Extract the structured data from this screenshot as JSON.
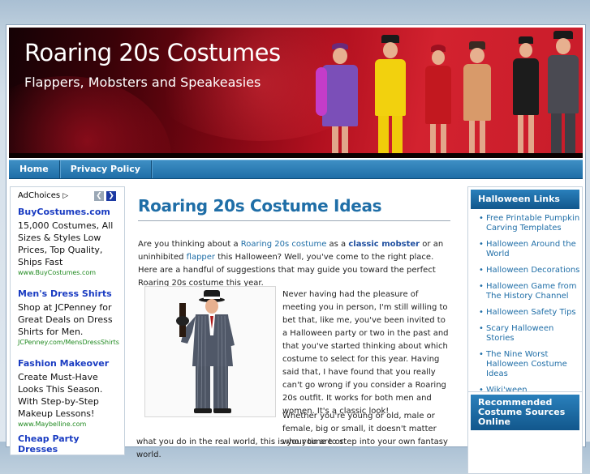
{
  "header": {
    "title": "Roaring 20s Costumes",
    "tagline": "Flappers, Mobsters and Speakeasies"
  },
  "nav": {
    "items": [
      {
        "label": "Home"
      },
      {
        "label": "Privacy Policy"
      }
    ]
  },
  "ads": {
    "adchoices_label": "AdChoices",
    "prev_label": "❮",
    "next_label": "❯",
    "items": [
      {
        "title": "BuyCostumes.com",
        "desc": "15,000 Costumes, All Sizes & Styles Low Prices, Top Quality, Ships Fast",
        "url": "www.BuyCostumes.com"
      },
      {
        "title": "Men's Dress Shirts",
        "desc": "Shop at JCPenney for Great Deals on Dress Shirts for Men.",
        "url": "JCPenney.com/MensDressShirts"
      },
      {
        "title": "Fashion Makeover",
        "desc": "Create Must-Have Looks This Season. With Step-by-Step Makeup Lessons!",
        "url": "www.Maybelline.com"
      },
      {
        "title": "Cheap Party Dresses",
        "desc": "",
        "url": ""
      }
    ]
  },
  "post": {
    "title": "Roaring 20s Costume Ideas",
    "p1_a": "Are you thinking about a ",
    "p1_link1": "Roaring 20s costume",
    "p1_b": " as a ",
    "p1_link2": "classic mobster",
    "p1_c": " or an uninhibited ",
    "p1_link3": "flapper",
    "p1_d": " this Halloween? Well, you've come to the right place. Here are a handful of suggestions that may guide you toward the perfect Roaring 20s costume this year.",
    "p2": "Never having had the pleasure of meeting you in person, I'm still willing to bet that, like me, you've been invited to a Halloween party or two in the past and that you've started thinking about which costume to select for this year. Having said that, I have found that you really can't go wrong if you consider a Roaring 20s outfit. It works for both men and women. It's a classic look!",
    "p3": "Whether you're young or old, male or female, big or small, it doesn't matter who you are or",
    "p3b": "what you do in the real world, this is your time to step into your own fantasy world."
  },
  "sidebar": {
    "links_title": "Halloween Links",
    "links": [
      {
        "label": "Free Printable Pumpkin Carving Templates"
      },
      {
        "label": "Halloween Around the World"
      },
      {
        "label": "Halloween Decorations"
      },
      {
        "label": "Halloween Game from The History Channel"
      },
      {
        "label": "Halloween Safety Tips"
      },
      {
        "label": "Scary Halloween Stories"
      },
      {
        "label": "The Nine Worst Halloween Costume Ideas"
      },
      {
        "label": "Wiki'ween"
      }
    ],
    "recommend_title": "Recommended Costume Sources Online"
  },
  "colors": {
    "accent": "#1f6ea7",
    "banner_red": "#c81c2a",
    "ad_link": "#1a3cc2",
    "ad_url": "#218a21"
  }
}
